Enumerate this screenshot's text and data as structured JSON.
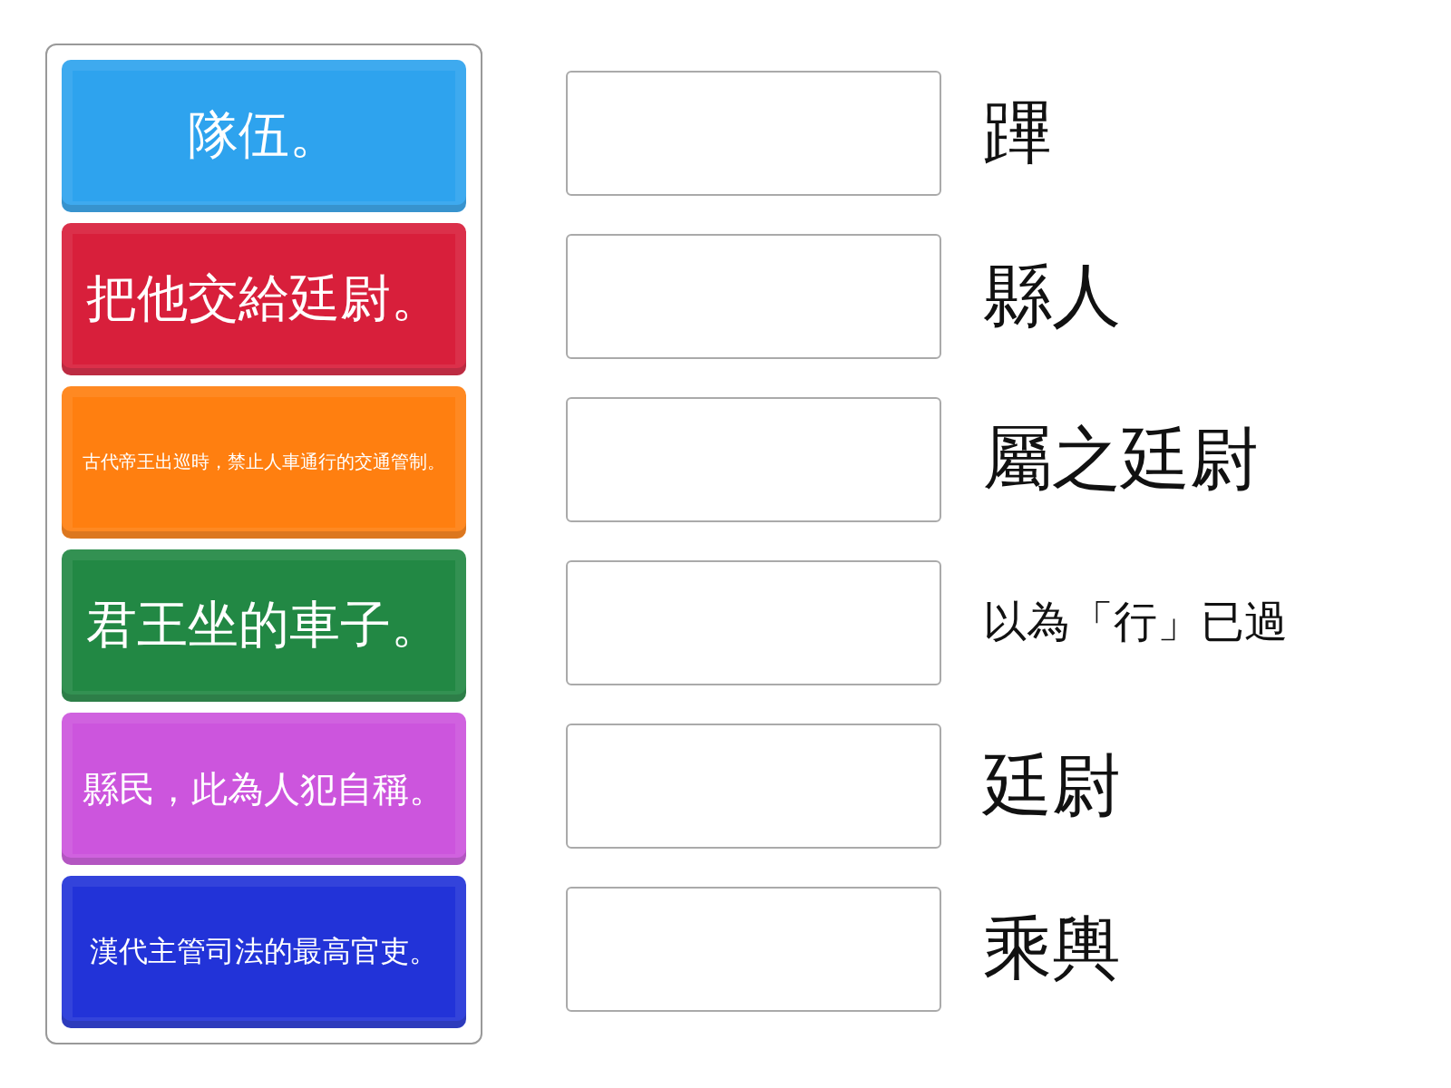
{
  "tiles": [
    {
      "text": "隊伍。",
      "color": "#2ea3ee"
    },
    {
      "text": "把他交給廷尉。",
      "color": "#d81f3b"
    },
    {
      "text": "古代帝王出巡時，禁止人車通行的交通管制。",
      "color": "#ff7f10"
    },
    {
      "text": "君王坐的車子。",
      "color": "#228844"
    },
    {
      "text": "縣民，此為人犯自稱。",
      "color": "#cc55dd"
    },
    {
      "text": "漢代主管司法的最高官吏。",
      "color": "#2233d8"
    }
  ],
  "prompts": [
    {
      "text": "蹕"
    },
    {
      "text": "縣人"
    },
    {
      "text": "屬之廷尉"
    },
    {
      "text": "以為「行」已過"
    },
    {
      "text": "廷尉"
    },
    {
      "text": "乘輿"
    }
  ]
}
